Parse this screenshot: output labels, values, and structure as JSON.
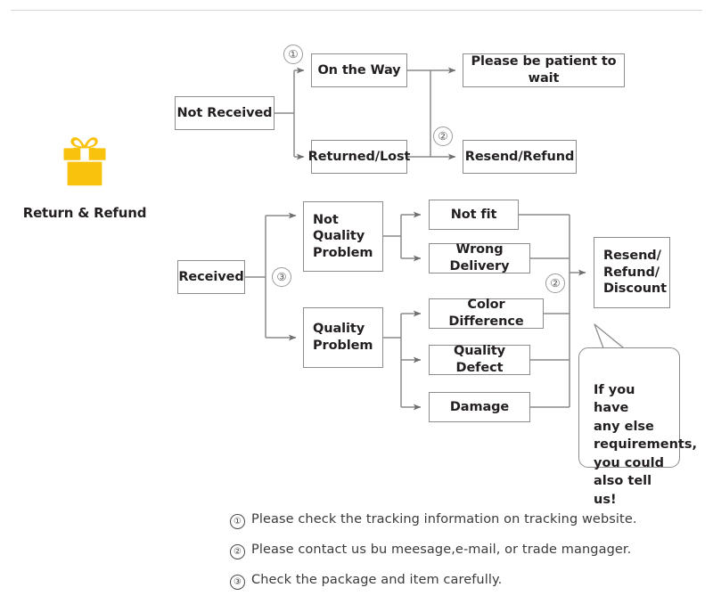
{
  "colors": {
    "gift": "#f8c20d",
    "box_border": "#8c8c8c",
    "wire": "#7f7f7f",
    "text": "#231f20",
    "rule": "#d8d8d8"
  },
  "brand": {
    "icon": "gift-box-icon",
    "caption": "Return & Refund"
  },
  "flow": {
    "not_received": {
      "label": "Not Received",
      "branches": [
        {
          "label": "On the Way",
          "marker": "①",
          "result": "Please be patient to wait"
        },
        {
          "label": "Returned/Lost",
          "marker": "②",
          "result": "Resend/Refund"
        }
      ]
    },
    "received": {
      "label": "Received",
      "marker": "③",
      "groups": [
        {
          "label": "Not\nQuality\nProblem",
          "reasons": [
            "Not fit",
            "Wrong Delivery"
          ]
        },
        {
          "label": "Quality\nProblem",
          "reasons": [
            "Color Difference",
            "Quality Defect",
            "Damage"
          ]
        }
      ],
      "outcome_marker": "②",
      "outcome": "Resend/\nRefund/\nDiscount"
    },
    "callout": "If you have\nany else\nrequirements,\nyou could\nalso tell us!"
  },
  "notes": [
    {
      "marker": "①",
      "text": "Please check the tracking information on tracking website."
    },
    {
      "marker": "②",
      "text": "Please contact us bu meesage,e-mail, or trade mangager."
    },
    {
      "marker": "③",
      "text": "Check the package and item carefully."
    }
  ]
}
